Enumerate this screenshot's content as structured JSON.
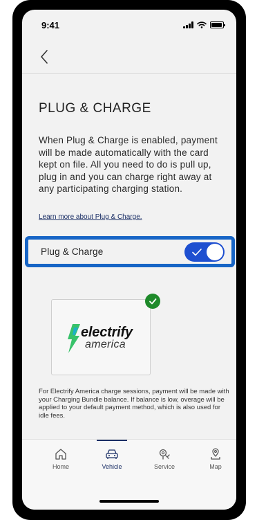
{
  "status_bar": {
    "time": "9:41",
    "icons": [
      "signal-icon",
      "wifi-icon",
      "battery-icon"
    ]
  },
  "nav": {
    "back_icon": "chevron-left-icon"
  },
  "page": {
    "title": "PLUG & CHARGE",
    "description": "When Plug & Charge is enabled, payment will be made automatically with the card kept on file. All you need to do is pull up, plug in and you can charge right away at any participating charging station.",
    "learn_more_link": "Learn more about Plug & Charge."
  },
  "toggle": {
    "label": "Plug & Charge",
    "enabled": true,
    "on_color": "#1e4fd0",
    "highlight_color": "#1765c6"
  },
  "provider": {
    "brand_name": "electrify",
    "brand_sub": "america",
    "selected": true,
    "selected_color": "#1e8a2a"
  },
  "footnote": "For Electrify America charge sessions, payment will be made with your Charging Bundle balance. If balance is low, overage will be applied to your default payment method, which is also used for idle fees.",
  "tab_bar": {
    "items": [
      {
        "label": "Home",
        "icon": "home-icon",
        "active": false
      },
      {
        "label": "Vehicle",
        "icon": "car-icon",
        "active": true
      },
      {
        "label": "Service",
        "icon": "service-icon",
        "active": false
      },
      {
        "label": "Map",
        "icon": "map-pin-icon",
        "active": false
      }
    ]
  }
}
